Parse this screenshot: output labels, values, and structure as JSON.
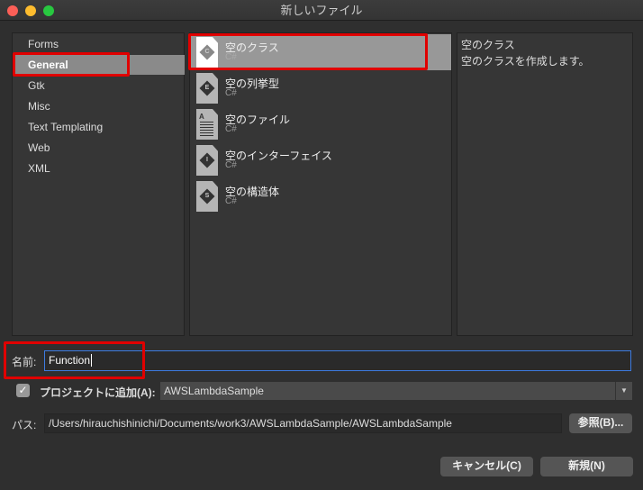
{
  "window": {
    "title": "新しいファイル"
  },
  "categories": [
    "Forms",
    "General",
    "Gtk",
    "Misc",
    "Text Templating",
    "Web",
    "XML"
  ],
  "selected_category": "General",
  "templates": [
    {
      "name": "空のクラス",
      "lang": "C#",
      "icon": "C"
    },
    {
      "name": "空の列挙型",
      "lang": "C#",
      "icon": "E"
    },
    {
      "name": "空のファイル",
      "lang": "C#",
      "icon": "A"
    },
    {
      "name": "空のインターフェイス",
      "lang": "C#",
      "icon": "I"
    },
    {
      "name": "空の構造体",
      "lang": "C#",
      "icon": "S"
    }
  ],
  "description": {
    "title": "空のクラス",
    "text": "空のクラスを作成します。"
  },
  "form": {
    "name_label": "名前:",
    "name_value": "Function",
    "add_label": "プロジェクトに追加(A):",
    "add_checked": true,
    "project": "AWSLambdaSample",
    "path_label": "パス:",
    "path_value": "/Users/hirauchishinichi/Documents/work3/AWSLambdaSample/AWSLambdaSample",
    "browse": "参照(B)..."
  },
  "buttons": {
    "cancel": "キャンセル(C)",
    "new": "新規(N)"
  },
  "colors": {
    "highlight": "#e00000",
    "focus": "#3d7be0"
  }
}
